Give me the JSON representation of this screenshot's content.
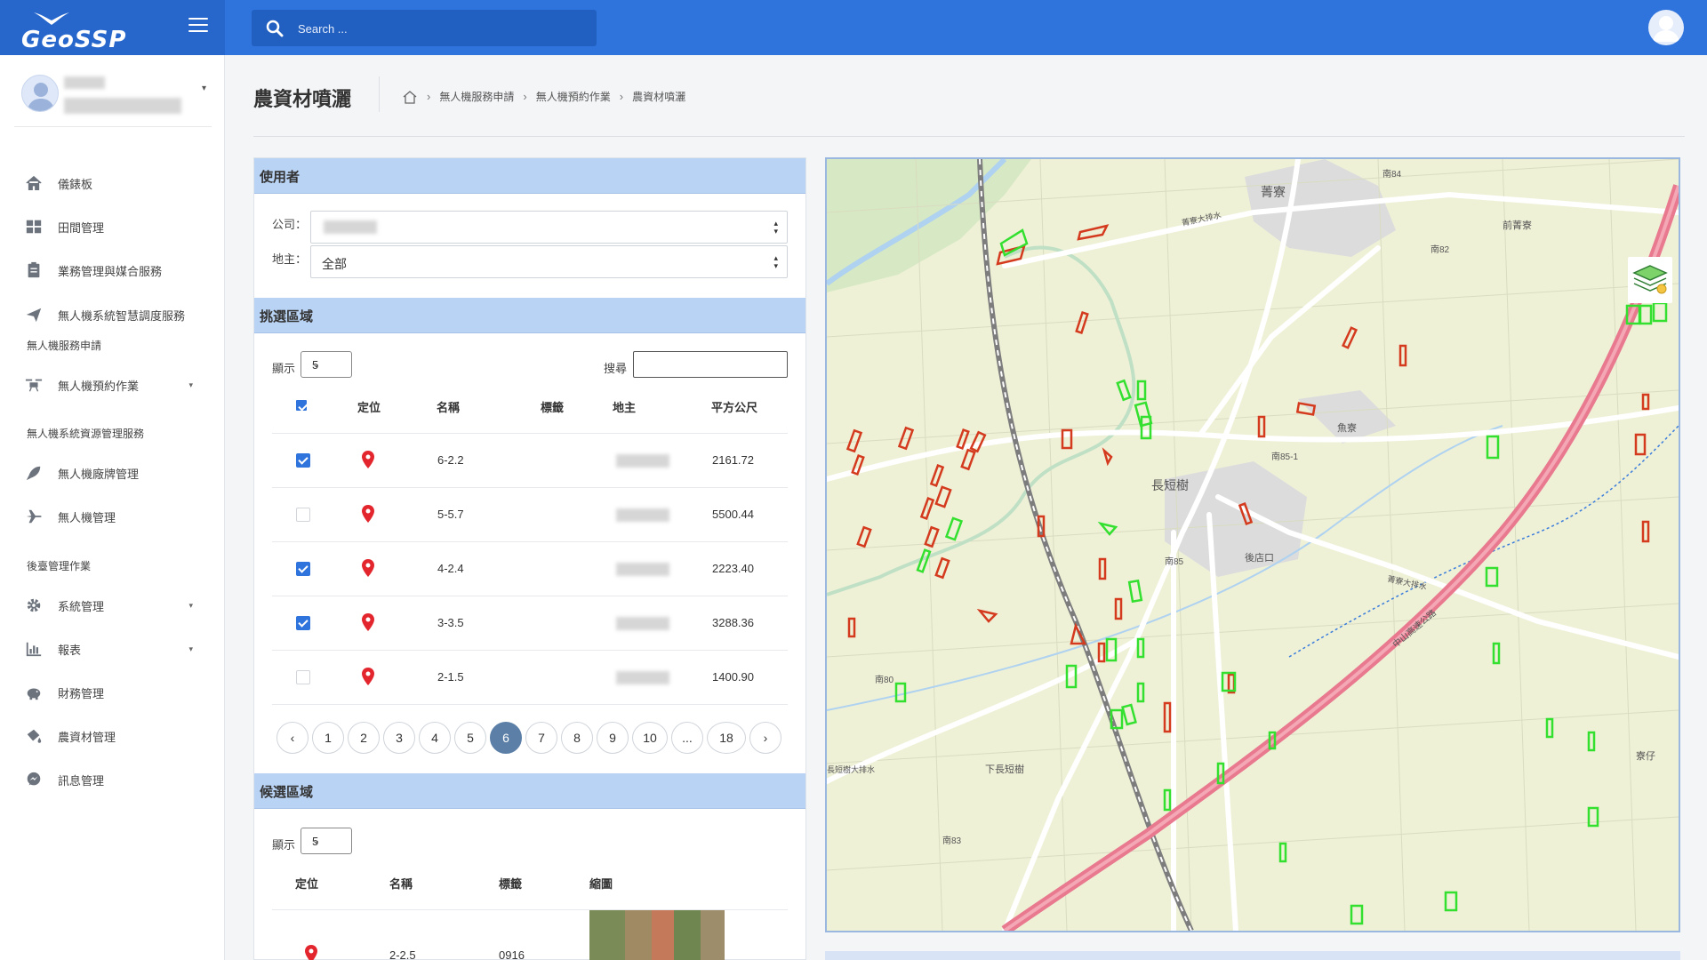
{
  "app": {
    "logo": "GeoSSP"
  },
  "topbar": {
    "search_placeholder": "Search ..."
  },
  "sidebar": {
    "items": [
      {
        "label": "儀錶板",
        "icon": "home-icon"
      },
      {
        "label": "田間管理",
        "icon": "grid-icon"
      },
      {
        "label": "業務管理與媒合服務",
        "icon": "clipboard-icon"
      },
      {
        "label": "無人機系統智慧調度服務",
        "icon": "send-icon"
      },
      {
        "label": "無人機預約作業",
        "icon": "drone-icon",
        "caret": "▾"
      },
      {
        "label": "無人機廠牌管理",
        "icon": "rocket-icon"
      },
      {
        "label": "無人機管理",
        "icon": "plane-icon"
      },
      {
        "label": "系統管理",
        "icon": "gear-icon",
        "caret": "▾"
      },
      {
        "label": "報表",
        "icon": "bar-chart-icon",
        "caret": "▾"
      },
      {
        "label": "財務管理",
        "icon": "piggy-bank-icon"
      },
      {
        "label": "農資材管理",
        "icon": "bucket-icon"
      },
      {
        "label": "訊息管理",
        "icon": "messenger-icon"
      }
    ],
    "sections": [
      "無人機服務申請",
      "無人機系統資源管理服務",
      "後臺管理作業"
    ]
  },
  "page": {
    "title": "農資材噴灑",
    "breadcrumb": [
      "無人機服務申請",
      "無人機預約作業",
      "農資材噴灑"
    ]
  },
  "user_panel": {
    "header": "使用者",
    "company_label": "公司：",
    "owner_label": "地主：",
    "owner_value": "全部"
  },
  "select_panel": {
    "header": "挑選區域",
    "show_label": "顯示",
    "page_size": "5",
    "search_label": "搜尋",
    "columns": [
      "定位",
      "名稱",
      "標籤",
      "地主",
      "平方公尺"
    ],
    "rows": [
      {
        "checked": true,
        "name": "6-2.2",
        "area": "2161.72"
      },
      {
        "checked": false,
        "name": "5-5.7",
        "area": "5500.44"
      },
      {
        "checked": true,
        "name": "4-2.4",
        "area": "2223.40"
      },
      {
        "checked": true,
        "name": "3-3.5",
        "area": "3288.36"
      },
      {
        "checked": false,
        "name": "2-1.5",
        "area": "1400.90"
      }
    ],
    "pagination": [
      "1",
      "2",
      "3",
      "4",
      "5",
      "6",
      "7",
      "8",
      "9",
      "10",
      "...",
      "18"
    ],
    "current_page": "6"
  },
  "candidate_panel": {
    "header": "候選區域",
    "show_label": "顯示",
    "page_size": "5",
    "columns": [
      "定位",
      "名稱",
      "標籤",
      "縮圖"
    ],
    "rows": [
      {
        "name": "2-2.5",
        "tag": "0916"
      }
    ]
  },
  "map": {
    "labels": [
      "菁寮",
      "前菁寮",
      "長短樹",
      "後店口",
      "下長短樹",
      "魚寮",
      "寮仔",
      "南84",
      "南82",
      "南85-1",
      "南85",
      "南80",
      "南83",
      "中山高速公路",
      "菁寮大排水",
      "長短樹大排水",
      "菁寮大排水"
    ],
    "colors": {
      "selected_field": "#d43a1e",
      "candidate_field": "#33e02f",
      "highway": "#e8798f",
      "railway": "#7d7d7d",
      "water": "#aed2f0"
    }
  }
}
